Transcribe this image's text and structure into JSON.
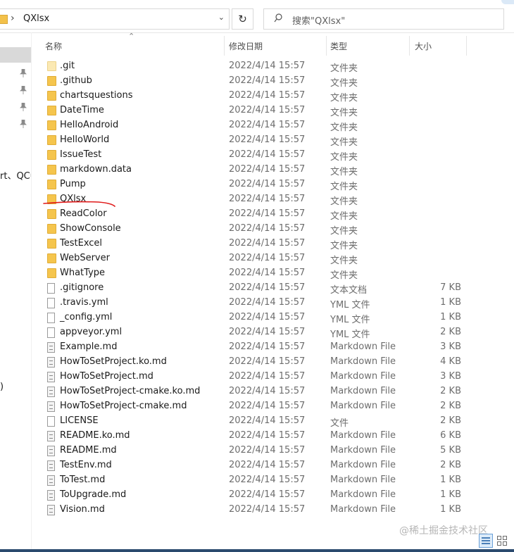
{
  "address": {
    "path": "QXlsx",
    "chevron": "›"
  },
  "search": {
    "placeholder": "搜索\"QXlsx\""
  },
  "nav": {
    "fragment_text": "rt、QCu",
    "fragment_text2": ")"
  },
  "headers": {
    "name": "名称",
    "date": "修改日期",
    "type": "类型",
    "size": "大小"
  },
  "files": [
    {
      "name": ".git",
      "date": "2022/4/14 15:57",
      "type": "文件夹",
      "size": "",
      "icon": "folder-light"
    },
    {
      "name": ".github",
      "date": "2022/4/14 15:57",
      "type": "文件夹",
      "size": "",
      "icon": "folder"
    },
    {
      "name": "chartsquestions",
      "date": "2022/4/14 15:57",
      "type": "文件夹",
      "size": "",
      "icon": "folder"
    },
    {
      "name": "DateTime",
      "date": "2022/4/14 15:57",
      "type": "文件夹",
      "size": "",
      "icon": "folder"
    },
    {
      "name": "HelloAndroid",
      "date": "2022/4/14 15:57",
      "type": "文件夹",
      "size": "",
      "icon": "folder"
    },
    {
      "name": "HelloWorld",
      "date": "2022/4/14 15:57",
      "type": "文件夹",
      "size": "",
      "icon": "folder"
    },
    {
      "name": "IssueTest",
      "date": "2022/4/14 15:57",
      "type": "文件夹",
      "size": "",
      "icon": "folder"
    },
    {
      "name": "markdown.data",
      "date": "2022/4/14 15:57",
      "type": "文件夹",
      "size": "",
      "icon": "folder"
    },
    {
      "name": "Pump",
      "date": "2022/4/14 15:57",
      "type": "文件夹",
      "size": "",
      "icon": "folder"
    },
    {
      "name": "QXlsx",
      "date": "2022/4/14 15:57",
      "type": "文件夹",
      "size": "",
      "icon": "folder"
    },
    {
      "name": "ReadColor",
      "date": "2022/4/14 15:57",
      "type": "文件夹",
      "size": "",
      "icon": "folder"
    },
    {
      "name": "ShowConsole",
      "date": "2022/4/14 15:57",
      "type": "文件夹",
      "size": "",
      "icon": "folder"
    },
    {
      "name": "TestExcel",
      "date": "2022/4/14 15:57",
      "type": "文件夹",
      "size": "",
      "icon": "folder"
    },
    {
      "name": "WebServer",
      "date": "2022/4/14 15:57",
      "type": "文件夹",
      "size": "",
      "icon": "folder"
    },
    {
      "name": "WhatType",
      "date": "2022/4/14 15:57",
      "type": "文件夹",
      "size": "",
      "icon": "folder"
    },
    {
      "name": ".gitignore",
      "date": "2022/4/14 15:57",
      "type": "文本文档",
      "size": "7 KB",
      "icon": "doc"
    },
    {
      "name": ".travis.yml",
      "date": "2022/4/14 15:57",
      "type": "YML 文件",
      "size": "1 KB",
      "icon": "doc"
    },
    {
      "name": "_config.yml",
      "date": "2022/4/14 15:57",
      "type": "YML 文件",
      "size": "1 KB",
      "icon": "doc"
    },
    {
      "name": "appveyor.yml",
      "date": "2022/4/14 15:57",
      "type": "YML 文件",
      "size": "2 KB",
      "icon": "doc"
    },
    {
      "name": "Example.md",
      "date": "2022/4/14 15:57",
      "type": "Markdown File",
      "size": "3 KB",
      "icon": "md"
    },
    {
      "name": "HowToSetProject.ko.md",
      "date": "2022/4/14 15:57",
      "type": "Markdown File",
      "size": "4 KB",
      "icon": "md"
    },
    {
      "name": "HowToSetProject.md",
      "date": "2022/4/14 15:57",
      "type": "Markdown File",
      "size": "3 KB",
      "icon": "md"
    },
    {
      "name": "HowToSetProject-cmake.ko.md",
      "date": "2022/4/14 15:57",
      "type": "Markdown File",
      "size": "2 KB",
      "icon": "md"
    },
    {
      "name": "HowToSetProject-cmake.md",
      "date": "2022/4/14 15:57",
      "type": "Markdown File",
      "size": "2 KB",
      "icon": "md"
    },
    {
      "name": "LICENSE",
      "date": "2022/4/14 15:57",
      "type": "文件",
      "size": "2 KB",
      "icon": "doc"
    },
    {
      "name": "README.ko.md",
      "date": "2022/4/14 15:57",
      "type": "Markdown File",
      "size": "6 KB",
      "icon": "md"
    },
    {
      "name": "README.md",
      "date": "2022/4/14 15:57",
      "type": "Markdown File",
      "size": "5 KB",
      "icon": "md"
    },
    {
      "name": "TestEnv.md",
      "date": "2022/4/14 15:57",
      "type": "Markdown File",
      "size": "2 KB",
      "icon": "md"
    },
    {
      "name": "ToTest.md",
      "date": "2022/4/14 15:57",
      "type": "Markdown File",
      "size": "1 KB",
      "icon": "md"
    },
    {
      "name": "ToUpgrade.md",
      "date": "2022/4/14 15:57",
      "type": "Markdown File",
      "size": "1 KB",
      "icon": "md"
    },
    {
      "name": "Vision.md",
      "date": "2022/4/14 15:57",
      "type": "Markdown File",
      "size": "1 KB",
      "icon": "md"
    }
  ],
  "watermark": "@稀土掘金技术社区",
  "colors": {
    "folder": "#f5c54d",
    "annotation_underline": "#e01b1b",
    "selection": "#d9d9d9"
  }
}
